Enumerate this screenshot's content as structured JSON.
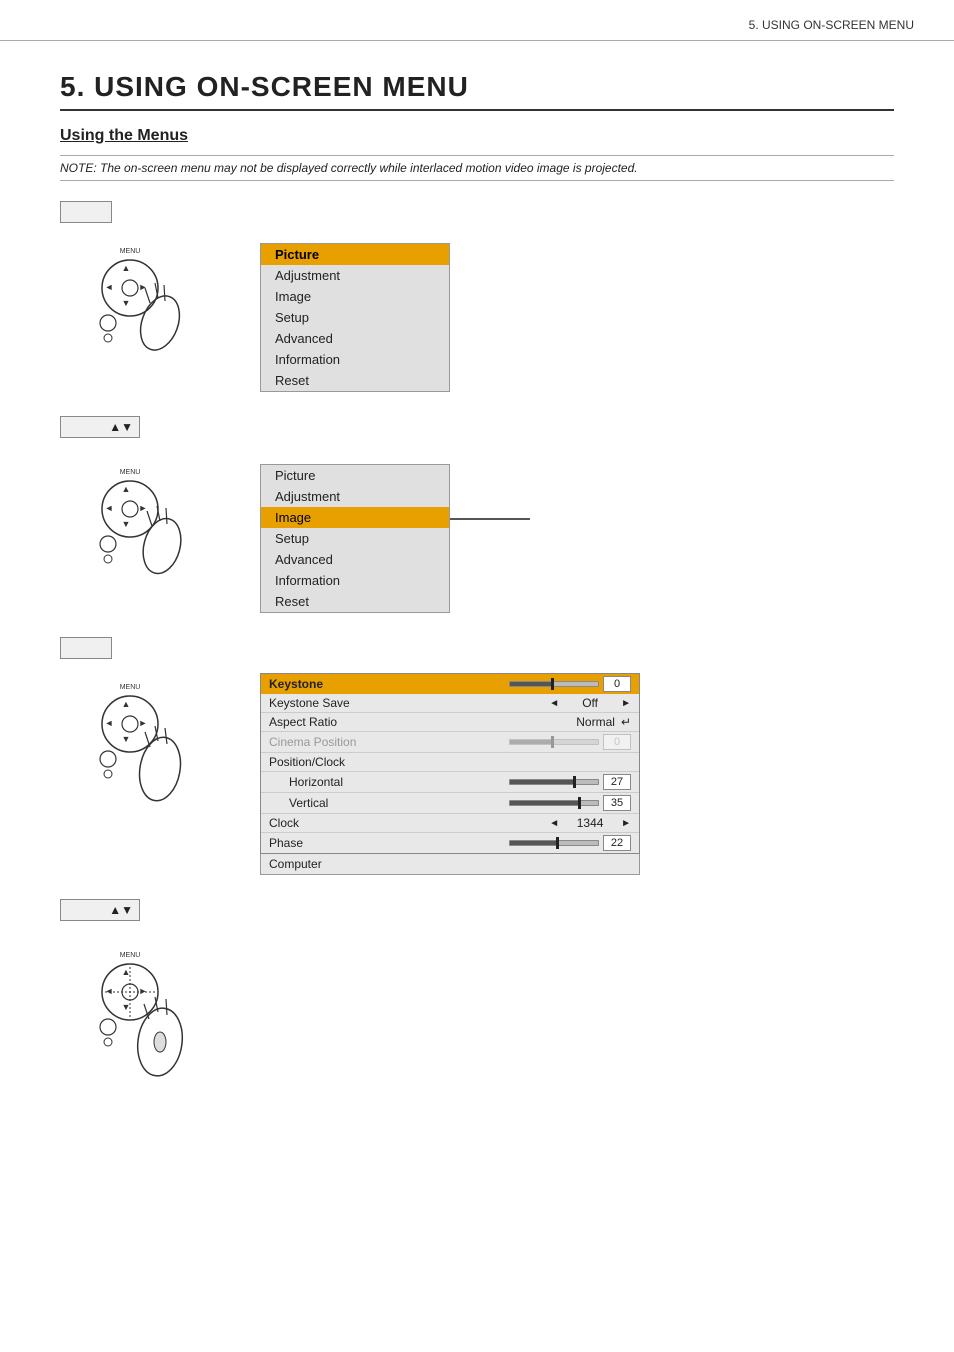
{
  "header": {
    "title": "5. USING ON-SCREEN MENU"
  },
  "main_title": "5. USING ON-SCREEN MENU",
  "section_title": "Using the Menus",
  "note": "NOTE: The on-screen menu may not be displayed correctly while interlaced motion video image is projected.",
  "menu1": {
    "items": [
      {
        "label": "Picture",
        "active": true
      },
      {
        "label": "Adjustment"
      },
      {
        "label": "Image"
      },
      {
        "label": "Setup"
      },
      {
        "label": "Advanced"
      },
      {
        "label": "Information"
      },
      {
        "label": "Reset"
      }
    ]
  },
  "menu2": {
    "items": [
      {
        "label": "Picture"
      },
      {
        "label": "Adjustment"
      },
      {
        "label": "Image",
        "active": true
      },
      {
        "label": "Setup"
      },
      {
        "label": "Advanced"
      },
      {
        "label": "Information"
      },
      {
        "label": "Reset"
      }
    ]
  },
  "image_submenu": {
    "rows": [
      {
        "label": "Keystone",
        "type": "slider",
        "value": "0",
        "active": true,
        "sliderPos": 50
      },
      {
        "label": "Keystone Save",
        "type": "arrow_value",
        "value": "Off"
      },
      {
        "label": "Aspect Ratio",
        "type": "value",
        "value": "Normal"
      },
      {
        "label": "Cinema Position",
        "type": "slider_disabled",
        "value": "0",
        "grayed": true,
        "sliderPos": 50
      },
      {
        "label": "Position/Clock",
        "type": "header"
      },
      {
        "label": "Horizontal",
        "type": "slider",
        "value": "27",
        "sliderPos": 75,
        "indent": true
      },
      {
        "label": "Vertical",
        "type": "slider",
        "value": "35",
        "sliderPos": 80,
        "indent": true
      },
      {
        "label": "Clock",
        "type": "arrow_value",
        "value": "1344"
      },
      {
        "label": "Phase",
        "type": "slider",
        "value": "22",
        "sliderPos": 55
      }
    ],
    "computer_bar": "Computer"
  },
  "nav_symbol": "▲▼",
  "icons": {
    "triangle_up_down": "▲▼"
  }
}
